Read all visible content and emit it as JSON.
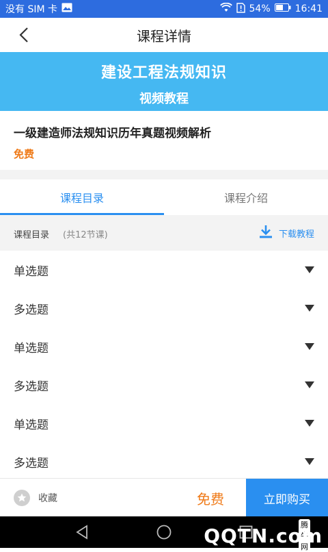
{
  "status_bar": {
    "carrier": "没有 SIM 卡",
    "battery": "54%",
    "time": "16:41"
  },
  "header": {
    "title": "课程详情"
  },
  "banner": {
    "line1": "建设工程法规知识",
    "line2": "视频教程"
  },
  "course": {
    "name": "一级建造师法规知识历年真题视频解析",
    "price": "免费"
  },
  "tabs": [
    {
      "label": "课程目录",
      "active": true
    },
    {
      "label": "课程介绍",
      "active": false
    }
  ],
  "catalog": {
    "title": "课程目录",
    "count": "(共12节课)",
    "download_label": "下载教程"
  },
  "list_items": [
    {
      "label": "单选题"
    },
    {
      "label": "多选题"
    },
    {
      "label": "单选题"
    },
    {
      "label": "多选题"
    },
    {
      "label": "单选题"
    },
    {
      "label": "多选题"
    }
  ],
  "bottom_bar": {
    "favorite_label": "收藏",
    "price": "免费",
    "buy_label": "立即购买"
  },
  "watermark": {
    "small": "腾牛网",
    "big": "QQTN.com"
  },
  "colors": {
    "status_bar": "#2d6cdf",
    "banner": "#45b8f2",
    "accent_blue": "#2a8ff0",
    "price_orange": "#ef7a18"
  }
}
